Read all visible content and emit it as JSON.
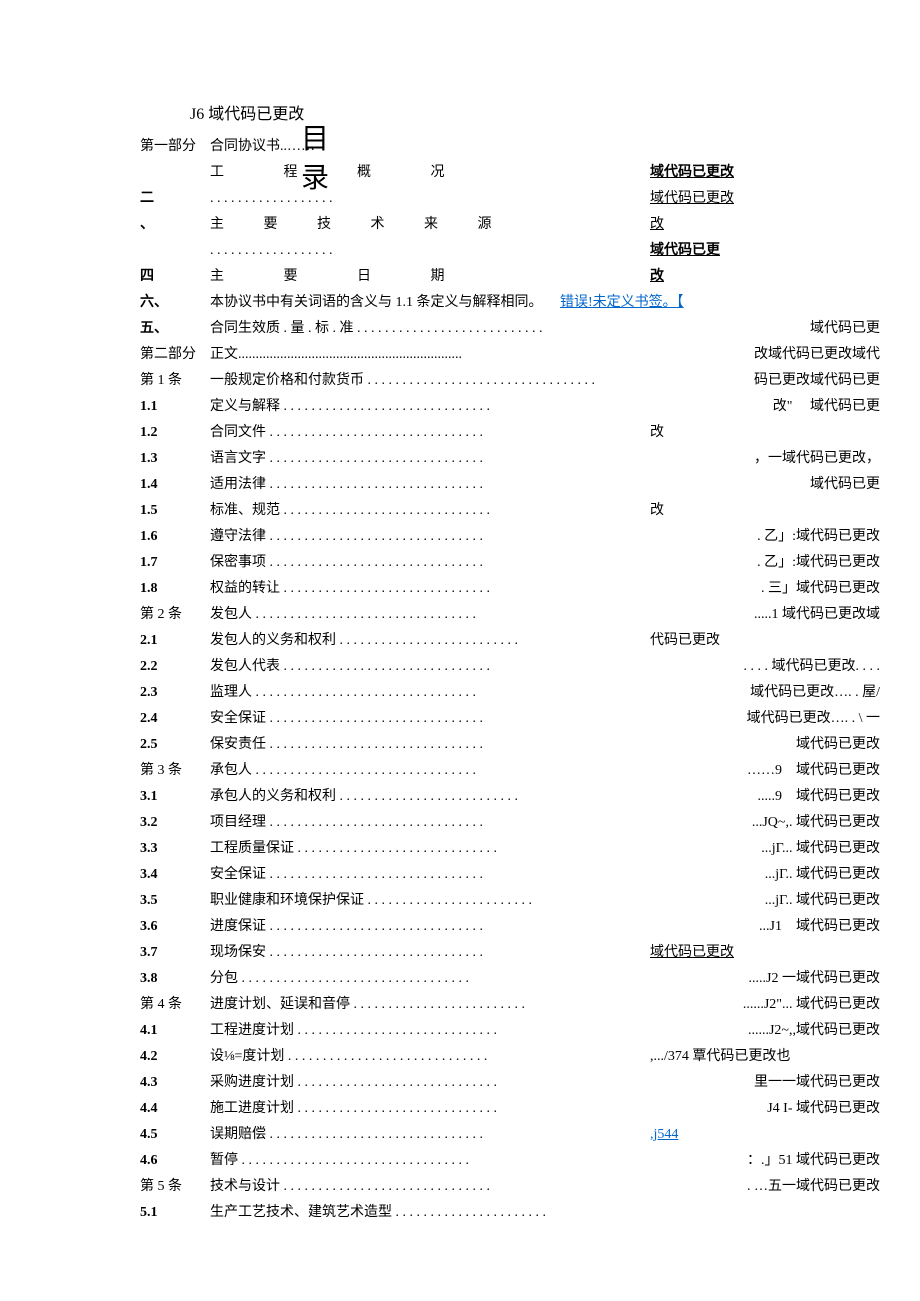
{
  "header": "J6 域代码已更改",
  "main_title": "目录",
  "toc": [
    {
      "num": "第一部分",
      "text": "合同协议书..……",
      "style": "",
      "right": ""
    },
    {
      "num": "",
      "text": "工 程 概 况",
      "style": "spread-wide",
      "right": "域代码已更改",
      "right_style": "underline bold"
    },
    {
      "num": "二",
      "text": ". . . . . . . . . . . . . . . . . .",
      "style": "",
      "right": "域代码已更改",
      "right_style": "underline"
    },
    {
      "num": "、",
      "text": "主 要 技 术 来 源",
      "style": "spread",
      "right": "改",
      "right_style": "underline"
    },
    {
      "num": "",
      "text": ". . . . . . . . . . . . . . . . . .",
      "style": "",
      "right": "域代码已更",
      "right_style": "underline bold"
    },
    {
      "num": "四",
      "text": "主 要 日 期",
      "style": "spread-wide",
      "right": "改",
      "right_style": "underline bold"
    },
    {
      "num": "六、",
      "text": "本协议书中有关词语的含义与 1.1 条定义与解释相同。",
      "style": "",
      "right": "错误!未定义书签。【",
      "right_style": "link",
      "right_pos": "mid"
    },
    {
      "num": "五、",
      "text": "合同生效质 . 量 . 标 . 准 . . . . . . . . . . . . . . . . . . . . . . . . . . .",
      "style": "",
      "right": "域代码已更"
    },
    {
      "num": "第二部分",
      "text": "正文................................................................",
      "style": "",
      "right": "改域代码已更改域代"
    },
    {
      "num": "第 1 条",
      "text": "一般规定价格和付款货币 . . . . . . . . . . . . . . . . . . . . . . . . . . . . . . . . .",
      "style": "",
      "right": "码已更改域代码已更"
    },
    {
      "num": "1.1",
      "text": "定义与解释",
      "dots": true,
      "right": "改\" 　域代码已更"
    },
    {
      "num": "1.2",
      "text": "合同文件",
      "dots": true,
      "right": "改"
    },
    {
      "num": "1.3",
      "text": "语言文字",
      "dots": true,
      "right": "，一域代码已更改，"
    },
    {
      "num": "1.4",
      "text": "适用法律",
      "dots": true,
      "right": "域代码已更"
    },
    {
      "num": "1.5",
      "text": "标准、规范",
      "dots": true,
      "right": "改"
    },
    {
      "num": "1.6",
      "text": "遵守法律",
      "dots": true,
      "right": ". 乙」:域代码已更改"
    },
    {
      "num": "1.7",
      "text": "保密事项",
      "dots": true,
      "right": ". 乙」:域代码已更改"
    },
    {
      "num": "1.8",
      "text": "权益的转让",
      "dots": true,
      "right": ". 三」域代码已更改"
    },
    {
      "num": "第 2 条",
      "text": "发包人",
      "dots": true,
      "right": ".....1 域代码已更改域"
    },
    {
      "num": "2.1",
      "text": "发包人的义务和权利",
      "dots": true,
      "right": "代码已更改"
    },
    {
      "num": "2.2",
      "text": "发包人代表",
      "dots": true,
      "right": ". . . . 域代码已更改. . . ."
    },
    {
      "num": "2.3",
      "text": "监理人",
      "dots": true,
      "right": "域代码已更改…. . 屋/"
    },
    {
      "num": "2.4",
      "text": "安全保证",
      "dots": true,
      "right": "域代码已更改…. . \\ 一"
    },
    {
      "num": "2.5",
      "text": "保安责任",
      "dots": true,
      "right": "域代码已更改"
    },
    {
      "num": "第 3 条",
      "text": "承包人",
      "dots": true,
      "right": "……9　域代码已更改"
    },
    {
      "num": "3.1",
      "text": "承包人的义务和权利",
      "dots": true,
      "right": ".....9　域代码已更改"
    },
    {
      "num": "3.2",
      "text": "项目经理",
      "dots": true,
      "right": "...JQ~,. 域代码已更改"
    },
    {
      "num": "3.3",
      "text": "工程质量保证",
      "dots": true,
      "right": "...jΓ... 域代码已更改"
    },
    {
      "num": "3.4",
      "text": "安全保证",
      "dots": true,
      "right": "...jΓ.. 域代码已更改"
    },
    {
      "num": "3.5",
      "text": "职业健康和环境保护保证",
      "dots": true,
      "right": "...jΓ.. 域代码已更改"
    },
    {
      "num": "3.6",
      "text": "进度保证",
      "dots": true,
      "right": "...J1　域代码已更改"
    },
    {
      "num": "3.7",
      "text": "现场保安",
      "dots": true,
      "right": "域代码已更改",
      "right_style": "underline"
    },
    {
      "num": "3.8",
      "text": "分包",
      "dots": true,
      "right": ".....J2 一域代码已更改"
    },
    {
      "num": "第 4 条",
      "text": "进度计划、延误和音停",
      "dots": true,
      "right": "......J2\"... 域代码已更改"
    },
    {
      "num": "4.1",
      "text": "工程进度计划",
      "dots": true,
      "right": "......J2~,,域代码已更改"
    },
    {
      "num": "4.2",
      "text": "设⅛=度计划",
      "dots": true,
      "right": ",.../374 覃代码已更改也"
    },
    {
      "num": "4.3",
      "text": "采购进度计划",
      "dots": true,
      "right": "里一一域代码已更改"
    },
    {
      "num": "4.4",
      "text": "施工进度计划",
      "dots": true,
      "right": "J4 I- 域代码已更改"
    },
    {
      "num": "4.5",
      "text": "误期赔偿",
      "dots": true,
      "right": ",j544",
      "right_style": "link"
    },
    {
      "num": "4.6",
      "text": "暂停",
      "dots": true,
      "right": "：.」51 域代码已更改"
    },
    {
      "num": "第 5 条",
      "text": "技术与设计",
      "dots": true,
      "right": ". …五一域代码已更改"
    },
    {
      "num": "5.1",
      "text": "生产工艺技术、建筑艺术造型",
      "dots": true,
      "right": ""
    }
  ]
}
